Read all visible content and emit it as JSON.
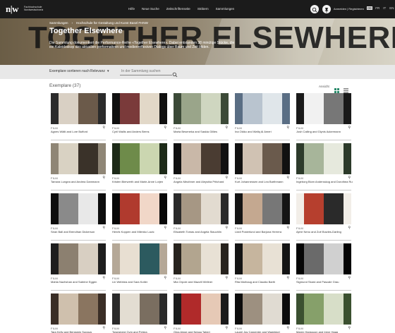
{
  "nav": {
    "logo": "n|w",
    "logo_sub": "Fachhochschule Nordwestschweiz",
    "links": [
      "Hilfe",
      "Neue Suche",
      "Zeitschriftenseite",
      "Stöbern",
      "Sammlungen"
    ],
    "login": "Anmelden | Registrieren",
    "languages": [
      "DE",
      "FR",
      "IT",
      "EN"
    ],
    "active_language": "DE"
  },
  "hero": {
    "big_text": "TOGETHER ELSEWHERE",
    "breadcrumb": [
      "Sammlungen",
      "Hochschule für Gestaltung und Kunst Basel FHNW"
    ],
    "title": "Together Elsewhere",
    "description": "Die Sammlung dokumentiert die Performance-Reihe «Together Elsewhere». Dabei entstanden 38 minütige Stücke, die ein Kaleidoskop des aktuellen performativen und medienreflexiven Dialogs über Raum und Zeit bilden."
  },
  "filter": {
    "sort_label": "Exemplare sortieren nach",
    "sort_value": "Relevanz",
    "search_placeholder": "In der Sammlung suchen"
  },
  "collection": {
    "count_label": "Exemplare (37)",
    "view_label": "Ansicht"
  },
  "cards": [
    {
      "category": "FILM",
      "names": "Agnes Wälti and Lore Bufford"
    },
    {
      "category": "FILM",
      "names": "Cyril Wallis and Anders Berns"
    },
    {
      "category": "FILM",
      "names": "Marta Beseneka and Saskia Gillies"
    },
    {
      "category": "FILM",
      "names": "Ina Okiko and Wafiq Al Ameri"
    },
    {
      "category": "FILM",
      "names": "Josh Calling and Glynis Ackermann"
    },
    {
      "category": "FILM",
      "names": "Tamara Lungea and Andrea Dammann"
    },
    {
      "category": "FILM",
      "names": "Kristen Bierwerth and Marie-Anne Lorjen"
    },
    {
      "category": "FILM",
      "names": "Angela Meuthner and Aleyshia Pritchard"
    },
    {
      "category": "FILM",
      "names": "Kurt Johannessen and Lea Barthmann"
    },
    {
      "category": "FILM",
      "names": "Ingeborg Blom Andersskog and Dorothea Rust"
    },
    {
      "category": "FILM",
      "names": "Sean Ball and Brendhan Dickerson"
    },
    {
      "category": "FILM",
      "names": "Henrik Koppen and Milenko Lazic"
    },
    {
      "category": "FILM",
      "names": "Elisabeth Tomas and Angela Stauchlin"
    },
    {
      "category": "FILM",
      "names": "Liddi Posterlund and Barjona Herrera"
    },
    {
      "category": "FILM",
      "names": "Ajere Neno and Zoë Bowles-Darling"
    },
    {
      "category": "FILM",
      "names": "Mahla Nazhshan and Sabrine Eggen"
    },
    {
      "category": "FILM",
      "names": "Lin Webbea and Sara Kotler"
    },
    {
      "category": "FILM",
      "names": "Mia Orpole and Mazzill Wellner"
    },
    {
      "category": "FILM",
      "names": "Rita Marhaug and Claudia Barth"
    },
    {
      "category": "FILM",
      "names": "Sigmund Skard and Pascale Grau"
    },
    {
      "category": "FILM",
      "names": "Tara Kelly and Benjamin Sunaya"
    },
    {
      "category": "FILM",
      "names": "Townsberd Gym and Petrea"
    },
    {
      "category": "FILM",
      "names": "Gina Ainge and Nessa Taheri"
    },
    {
      "category": "FILM",
      "names": "Laurel Jay Carpenter and Wadekkel"
    },
    {
      "category": "FILM",
      "names": "Maren Hanssoon and Irene Haag"
    }
  ]
}
